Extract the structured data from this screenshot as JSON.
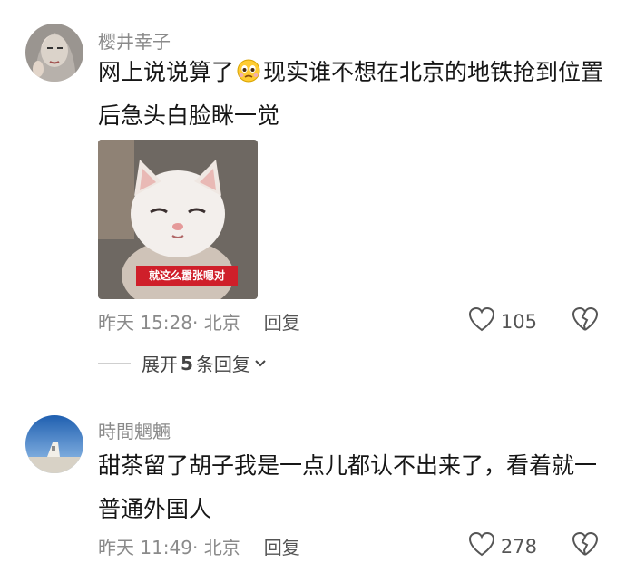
{
  "comments": [
    {
      "username": "樱井幸子",
      "text_part1": "网上说说算了",
      "emoji": "crying-face-emoji",
      "text_part2": "现实谁不想在北京的地铁抢到位置后急头白脸眯一觉",
      "sticker_caption": "就这么嚣张嗯对",
      "time": "昨天 15:28",
      "location": "· 北京",
      "reply_label": "回复",
      "like_count": "105",
      "expand_prefix": "展开",
      "expand_count": "5",
      "expand_suffix": "条回复"
    },
    {
      "username": "時間魍魎",
      "text": "甜茶留了胡子我是一点儿都认不出来了，看着就一普通外国人",
      "time": "昨天 11:49",
      "location": "· 北京",
      "reply_label": "回复",
      "like_count": "278"
    }
  ],
  "colors": {
    "meta": "#8a8a8a",
    "text": "#161616",
    "sticker_caption_bg": "#cf1f2a"
  }
}
